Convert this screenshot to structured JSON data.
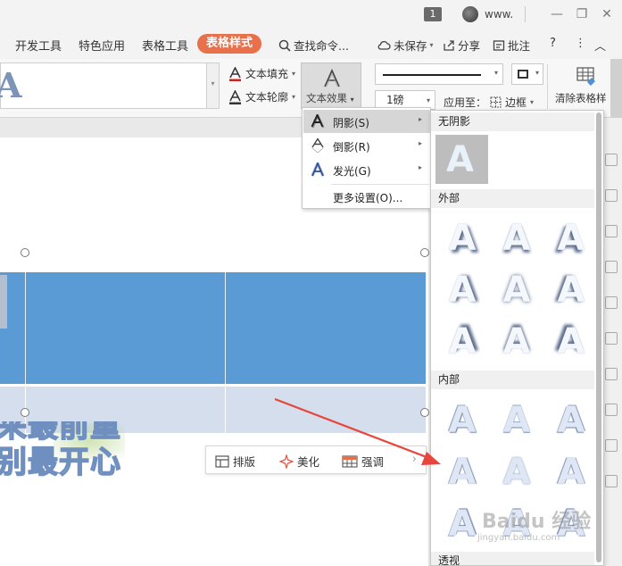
{
  "titlebar": {
    "badge": "1",
    "user": "www.",
    "min_btn": "—",
    "restore_btn": "❐",
    "close_btn": "✕"
  },
  "tabs": {
    "items": [
      "开发工具",
      "特色应用",
      "表格工具"
    ],
    "active": "表格样式",
    "search": "查找命令...",
    "save_status": "未保存",
    "share": "分享",
    "comment": "批注",
    "help": "?",
    "more": "⋮",
    "collapse": "︿"
  },
  "ribbon": {
    "text_fill": "文本填充",
    "text_outline": "文本轮廓",
    "text_effect": "文本效果",
    "line_weight": "1磅",
    "apply_to": "应用至：",
    "border": "边框",
    "clear_table_style": "清除表格样"
  },
  "fx_menu": {
    "items": [
      {
        "label": "阴影(S)",
        "has_submenu": true,
        "highlighted": true
      },
      {
        "label": "倒影(R)",
        "has_submenu": true,
        "highlighted": false
      },
      {
        "label": "发光(G)",
        "has_submenu": true,
        "highlighted": false
      },
      {
        "label": "更多设置(O)...",
        "has_submenu": false,
        "highlighted": false
      }
    ]
  },
  "shadow_panel": {
    "sections": [
      "无阴影",
      "外部",
      "内部",
      "透视"
    ],
    "glyph": "A"
  },
  "document": {
    "deco_line1": "采最前重",
    "deco_line2": "别最开心"
  },
  "float_bar": {
    "layout": "排版",
    "beautify": "美化",
    "emphasis": "强调",
    "more": "›"
  },
  "watermark": {
    "text": "Baidu 经验",
    "sub": "jingyan.baidu.com"
  },
  "colors": {
    "accent": "#e8704b",
    "table_header": "#5b9bd5",
    "table_row": "#d4deed",
    "arrow": "#e8453c"
  }
}
